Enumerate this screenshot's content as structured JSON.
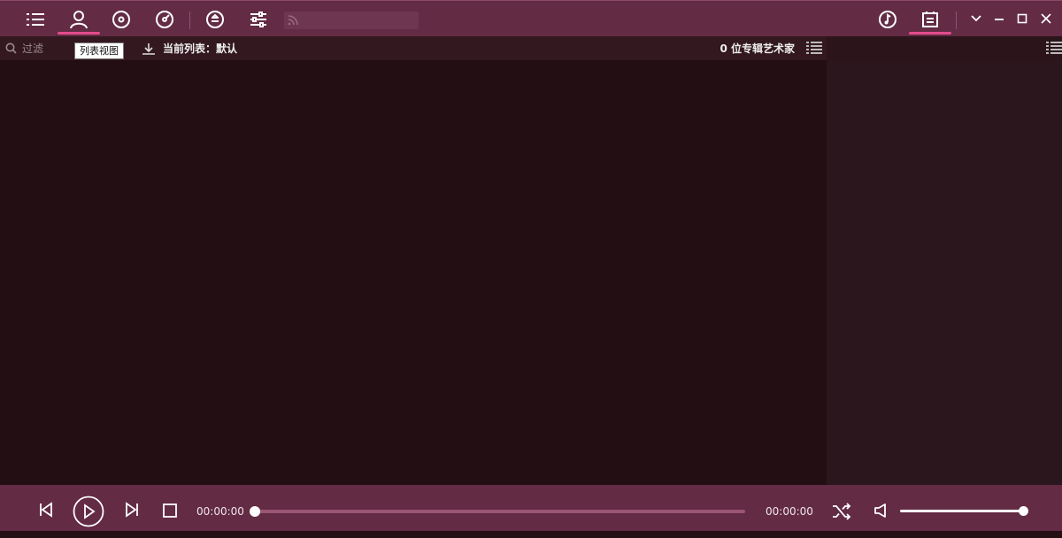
{
  "toolbar": {
    "nav_buttons": [
      "list-icon",
      "artist-icon",
      "album-icon",
      "genre-icon",
      "queue-icon",
      "equalizer-icon"
    ],
    "search_placeholder": "",
    "right_buttons": [
      "now-playing-icon",
      "playlist-icon"
    ]
  },
  "window_controls": [
    "chevron-down-icon",
    "minimize-icon",
    "maximize-icon",
    "close-icon"
  ],
  "subbar": {
    "filter_placeholder": "过滤",
    "tooltip": "列表视图",
    "current_list_label": "当前列表：默认",
    "artist_count_label": "0 位专辑艺术家"
  },
  "player": {
    "elapsed": "00:00:00",
    "duration": "00:00:00",
    "progress_fraction": 0,
    "volume_fraction": 1
  },
  "colors": {
    "accent": "#e44c8d",
    "toolbar_bg": "#632b44",
    "content_bg": "#230e13"
  }
}
